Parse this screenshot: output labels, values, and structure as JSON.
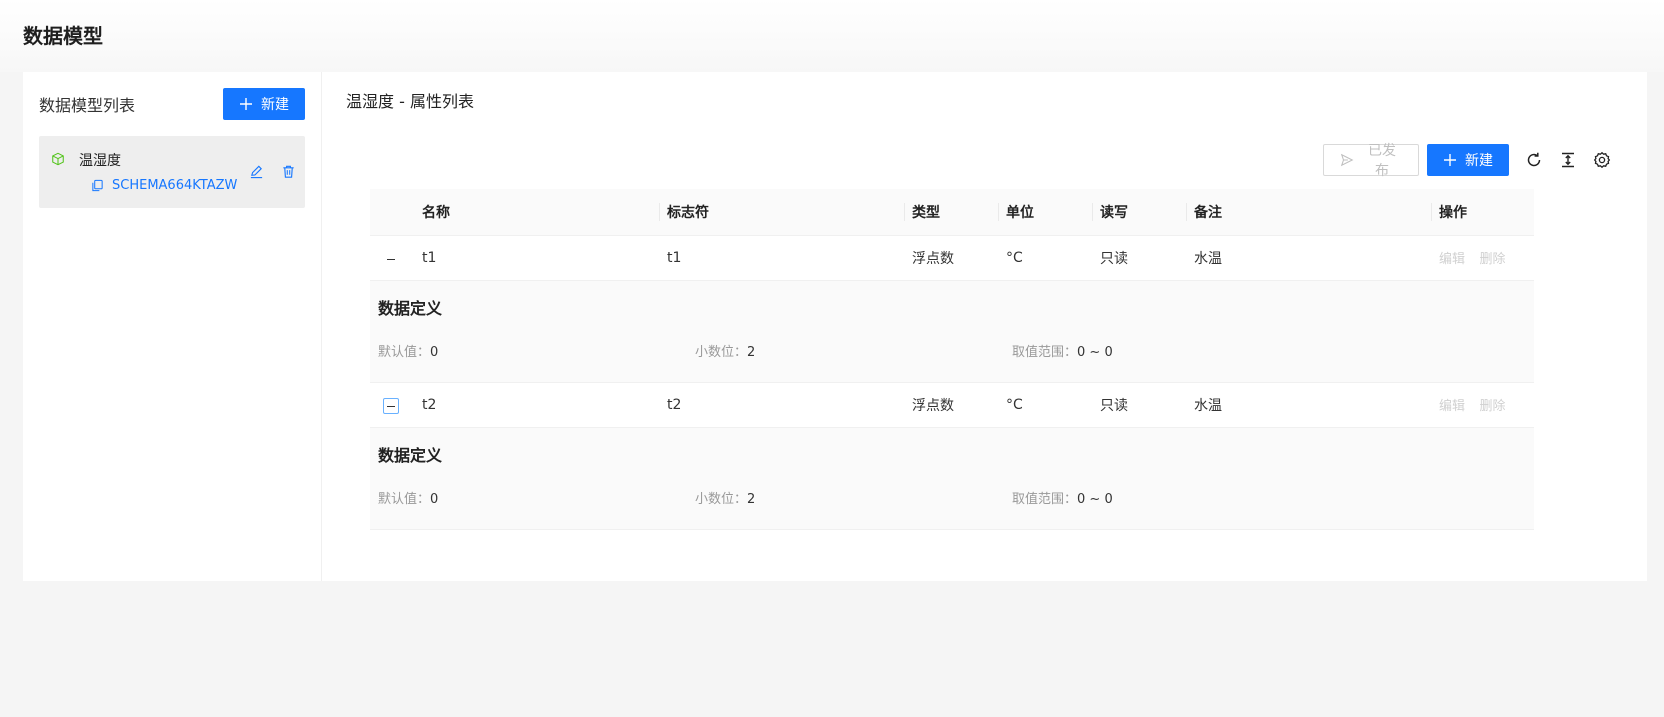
{
  "page": {
    "title": "数据模型"
  },
  "left": {
    "title": "数据模型列表",
    "new_label": "新建",
    "models": [
      {
        "name": "温湿度",
        "schema": "SCHEMA664KTAZW"
      }
    ]
  },
  "right": {
    "title": "温湿度 - 属性列表",
    "toolbar": {
      "publish_label": "已发布",
      "new_label": "新建"
    },
    "table": {
      "columns": [
        "名称",
        "标志符",
        "类型",
        "单位",
        "读写",
        "备注",
        "操作"
      ],
      "rows": [
        {
          "name": "t1",
          "identifier": "t1",
          "type": "浮点数",
          "unit": "°C",
          "rw": "只读",
          "note": "水温",
          "actions": [
            "编辑",
            "删除"
          ],
          "detail": {
            "title": "数据定义",
            "default_label": "默认值：",
            "default_value": "0",
            "decimal_label": "小数位：",
            "decimal_value": "2",
            "range_label": "取值范围：",
            "range_value": "0 ~ 0"
          }
        },
        {
          "name": "t2",
          "identifier": "t2",
          "type": "浮点数",
          "unit": "°C",
          "rw": "只读",
          "note": "水温",
          "actions": [
            "编辑",
            "删除"
          ],
          "detail": {
            "title": "数据定义",
            "default_label": "默认值：",
            "default_value": "0",
            "decimal_label": "小数位：",
            "decimal_value": "2",
            "range_label": "取值范围：",
            "range_value": "0 ~ 0"
          }
        }
      ]
    }
  },
  "colors": {
    "primary": "#1677ff",
    "model_icon": "#52c41a"
  },
  "icons": [
    "plus-icon",
    "cube-icon",
    "copy-icon",
    "edit-icon",
    "delete-icon",
    "send-icon",
    "reload-icon",
    "column-height-icon",
    "setting-icon",
    "minus-icon"
  ]
}
